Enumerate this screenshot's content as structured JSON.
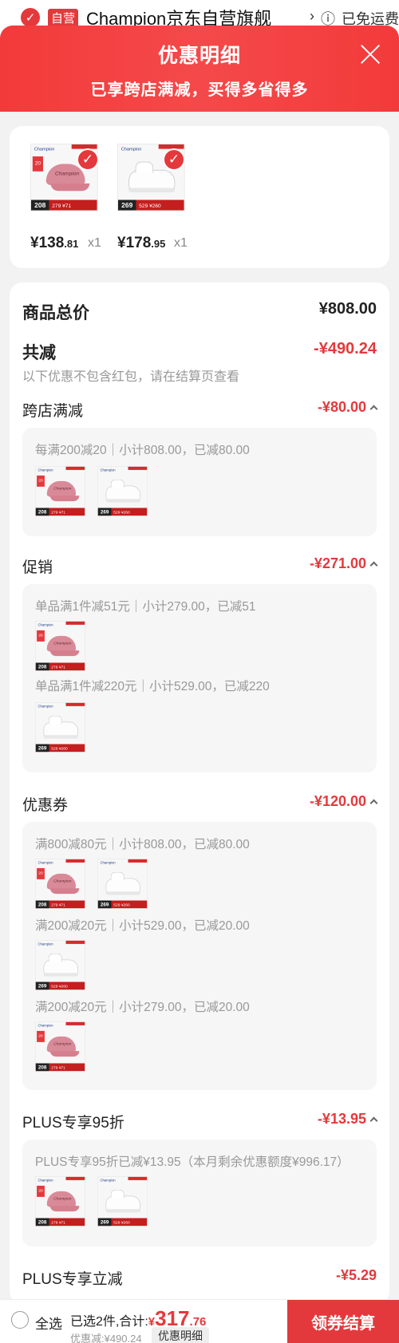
{
  "background": {
    "store_name": "Champion京东自营旗舰",
    "store_badge": "自营",
    "shipping_hint": "已免运费"
  },
  "header": {
    "title": "优惠明细",
    "subtitle": "已享跨店满减，买得多省得多"
  },
  "products": [
    {
      "name": "cap",
      "price_int": "¥138",
      "price_dec": ".81",
      "qty": "x1",
      "badge": "208"
    },
    {
      "name": "shoe",
      "price_int": "¥178",
      "price_dec": ".95",
      "qty": "x1",
      "badge": "269"
    }
  ],
  "summary": {
    "total_label": "商品总价",
    "total_value": "¥808.00",
    "reduce_label": "共减",
    "reduce_value": "-¥490.24",
    "note": "以下优惠不包含红包，请在结算页查看"
  },
  "sections": {
    "cross_store": {
      "label": "跨店满减",
      "amount": "-¥80.00",
      "rule": "每满200减20｜小计808.00，已减80.00"
    },
    "promo": {
      "label": "促销",
      "amount": "-¥271.00",
      "rule1": "单品满1件减51元｜小计279.00，已减51",
      "rule2": "单品满1件减220元｜小计529.00，已减220"
    },
    "coupon": {
      "label": "优惠券",
      "amount": "-¥120.00",
      "rule1": "满800减80元｜小计808.00，已减80.00",
      "rule2": "满200减20元｜小计529.00，已减20.00",
      "rule3": "满200减20元｜小计279.00，已减20.00"
    },
    "plus95": {
      "label": "PLUS专享95折",
      "amount": "-¥13.95",
      "rule": "PLUS专享95折已减¥13.95（本月剩余优惠额度¥996.17）"
    },
    "plus_direct": {
      "label": "PLUS专享立减",
      "amount": "-¥5.29"
    }
  },
  "bottom_bar": {
    "select_all": "全选",
    "selected_text": "已选2件,合计:",
    "currency": "¥",
    "total_int": "317",
    "total_dec": ".76",
    "discount_text": "优惠减:¥490.24",
    "detail_button": "优惠明细",
    "checkout_button": "领券结算"
  },
  "colors": {
    "accent": "#e4393c",
    "header_bg": "#f33a3a"
  }
}
